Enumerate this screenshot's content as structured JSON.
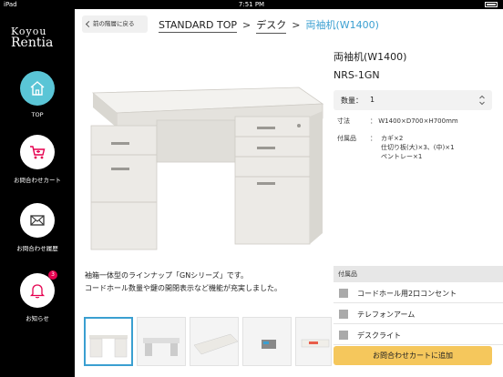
{
  "status_bar": {
    "carrier": "iPad",
    "time": "7:51 PM"
  },
  "sidebar": {
    "logo_line1": "Koyou",
    "logo_line2": "Rentia",
    "items": [
      {
        "label": "TOP",
        "icon": "home-icon"
      },
      {
        "label": "お問合わせカート",
        "icon": "cart-icon"
      },
      {
        "label": "お問合わせ履歴",
        "icon": "mail-icon"
      },
      {
        "label": "お知らせ",
        "icon": "bell-icon",
        "badge": "3"
      }
    ]
  },
  "header": {
    "back_label": "前の階層に戻る",
    "breadcrumbs": [
      "STANDARD TOP",
      "デスク",
      "両袖机(W1400)"
    ],
    "separator": ">"
  },
  "product": {
    "title": "両袖机(W1400)",
    "code": "NRS-1GN",
    "quantity_label": "数量：",
    "quantity_value": "1",
    "size_label": "寸法",
    "size_value": "W1400×D700×H700mm",
    "accessories_label": "付属品",
    "accessories_value": [
      "カギ×2",
      "仕切り板(大)×3、(中)×1",
      "ペントレー×1"
    ],
    "description_line1": "袖箱一体型のラインナップ「GNシリーズ」です。",
    "description_line2": "コードホール数量や鍵の開閉表示など機能が充実しました。"
  },
  "options": {
    "header": "付属品",
    "items": [
      "コードホール用2口コンセント",
      "テレフォンアーム",
      "デスクライト"
    ]
  },
  "cart_button_label": "お問合わせカートに追加",
  "colors": {
    "accent": "#3a9fd1",
    "nav_active": "#5ac5d6",
    "cart_button": "#f5c75c",
    "badge": "#e5004f"
  }
}
